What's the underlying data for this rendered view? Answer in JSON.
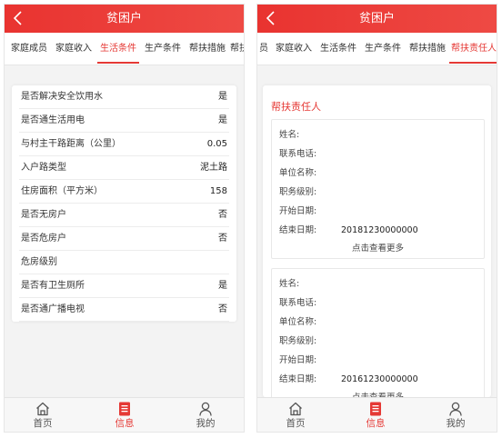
{
  "left": {
    "header": {
      "title": "贫困户"
    },
    "tabs": [
      {
        "label": "家庭成员",
        "active": false
      },
      {
        "label": "家庭收入",
        "active": false
      },
      {
        "label": "生活条件",
        "active": true
      },
      {
        "label": "生产条件",
        "active": false
      },
      {
        "label": "帮扶措施",
        "active": false
      },
      {
        "label": "帮扶",
        "active": false
      }
    ],
    "conditions": [
      {
        "label": "是否解决安全饮用水",
        "value": "是"
      },
      {
        "label": "是否通生活用电",
        "value": "是"
      },
      {
        "label": "与村主干路距离（公里）",
        "value": "0.05"
      },
      {
        "label": "入户路类型",
        "value": "泥土路"
      },
      {
        "label": "住房面积（平方米）",
        "value": "158"
      },
      {
        "label": "是否无房户",
        "value": "否"
      },
      {
        "label": "是否危房户",
        "value": "否"
      },
      {
        "label": "危房级别",
        "value": ""
      },
      {
        "label": "是否有卫生厕所",
        "value": "是"
      },
      {
        "label": "是否通广播电视",
        "value": "否"
      }
    ],
    "nav": [
      {
        "label": "首页",
        "icon": "home-icon",
        "active": false
      },
      {
        "label": "信息",
        "icon": "document-icon",
        "active": true
      },
      {
        "label": "我的",
        "icon": "user-icon",
        "active": false
      }
    ]
  },
  "right": {
    "header": {
      "title": "贫困户"
    },
    "tabs": [
      {
        "label": "员",
        "active": false
      },
      {
        "label": "家庭收入",
        "active": false
      },
      {
        "label": "生活条件",
        "active": false
      },
      {
        "label": "生产条件",
        "active": false
      },
      {
        "label": "帮扶措施",
        "active": false
      },
      {
        "label": "帮扶责任人",
        "active": true
      }
    ],
    "section_title": "帮扶责任人",
    "fields": [
      "姓名:",
      "联系电话:",
      "单位名称:",
      "职务级别:",
      "开始日期:",
      "结束日期:"
    ],
    "persons": [
      {
        "values": [
          "",
          "",
          "",
          "",
          "",
          "20181230000000"
        ],
        "more": "点击查看更多"
      },
      {
        "values": [
          "",
          "",
          "",
          "",
          "",
          "20161230000000"
        ],
        "more": "点击查看更多"
      }
    ],
    "nav": [
      {
        "label": "首页",
        "icon": "home-icon",
        "active": false
      },
      {
        "label": "信息",
        "icon": "document-icon",
        "active": true
      },
      {
        "label": "我的",
        "icon": "user-icon",
        "active": false
      }
    ]
  },
  "colors": {
    "primary": "#e53935",
    "header": "#ea3a35",
    "background": "#f3f3f3"
  }
}
